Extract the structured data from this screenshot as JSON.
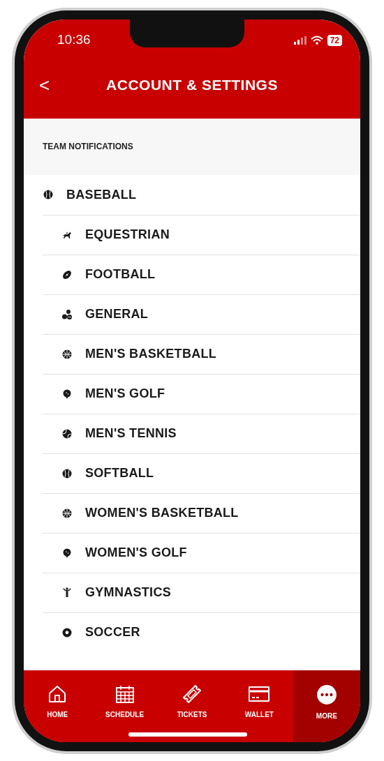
{
  "status_bar": {
    "time": "10:36",
    "battery": "72"
  },
  "header": {
    "back": "<",
    "title": "ACCOUNT & SETTINGS"
  },
  "section": {
    "title": "TEAM NOTIFICATIONS"
  },
  "items": [
    {
      "label": "BASEBALL",
      "kind": "baseball"
    },
    {
      "label": "EQUESTRIAN",
      "kind": "equestrian"
    },
    {
      "label": "FOOTBALL",
      "kind": "football"
    },
    {
      "label": "GENERAL",
      "kind": "general"
    },
    {
      "label": "MEN'S BASKETBALL",
      "kind": "basketball"
    },
    {
      "label": "MEN'S GOLF",
      "kind": "golf"
    },
    {
      "label": "MEN'S TENNIS",
      "kind": "tennis"
    },
    {
      "label": "SOFTBALL",
      "kind": "baseball"
    },
    {
      "label": "WOMEN'S BASKETBALL",
      "kind": "basketball"
    },
    {
      "label": "WOMEN'S GOLF",
      "kind": "golf"
    },
    {
      "label": "GYMNASTICS",
      "kind": "gymnastics"
    },
    {
      "label": "SOCCER",
      "kind": "soccer"
    }
  ],
  "tab_bar": [
    {
      "label": "HOME",
      "kind": "home",
      "selected": false
    },
    {
      "label": "SCHEDULE",
      "kind": "schedule",
      "selected": false
    },
    {
      "label": "TICKETS",
      "kind": "tickets",
      "selected": false
    },
    {
      "label": "WALLET",
      "kind": "wallet",
      "selected": false
    },
    {
      "label": "MORE",
      "kind": "more",
      "selected": true
    }
  ]
}
